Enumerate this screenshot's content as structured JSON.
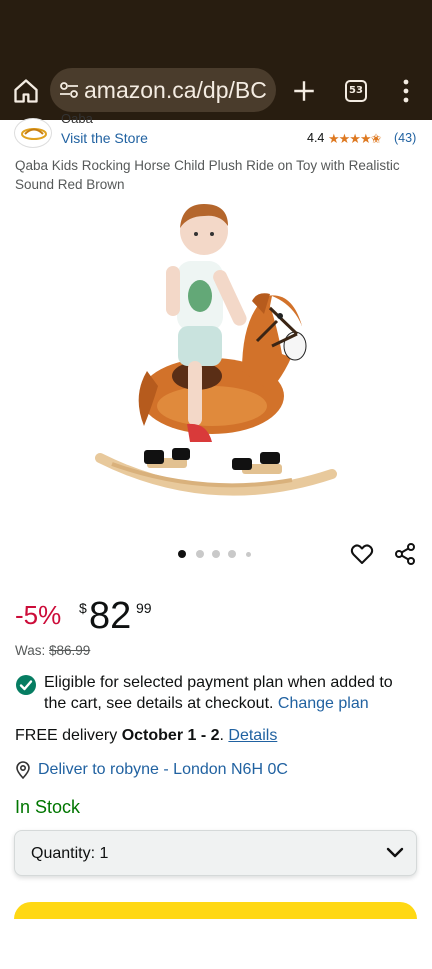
{
  "browser": {
    "url": "amazon.ca/dp/BC",
    "tab_count": "53"
  },
  "brand": {
    "name": "Qaba",
    "visit_store": "Visit the Store"
  },
  "rating": {
    "value": "4.4",
    "stars": "★★★★✬",
    "count": "(43)",
    "star_color": "#de7921"
  },
  "product": {
    "title": "Qaba Kids Rocking Horse Child Plush Ride on Toy with Realistic Sound Red Brown",
    "image_count": 5,
    "active_image": 1
  },
  "price": {
    "discount": "-5%",
    "currency": "$",
    "whole": "82",
    "fraction": "99",
    "was_label": "Was: ",
    "was_value": "$86.99"
  },
  "payment": {
    "text": "Eligible for selected payment plan when added to the cart, see details at checkout. ",
    "link": "Change plan"
  },
  "delivery": {
    "prefix": "FREE delivery ",
    "dates": "October 1 - 2",
    "suffix": ". ",
    "details_link": "Details",
    "deliver_to": "Deliver to robyne - London N6H 0C"
  },
  "stock": {
    "status": "In Stock",
    "color": "#007600"
  },
  "quantity": {
    "label": "Quantity: ",
    "value": "1"
  },
  "colors": {
    "chrome_bg": "#281d10",
    "link": "#2162a1",
    "discount": "#cc0c39",
    "add_to_cart": "#ffd814"
  }
}
